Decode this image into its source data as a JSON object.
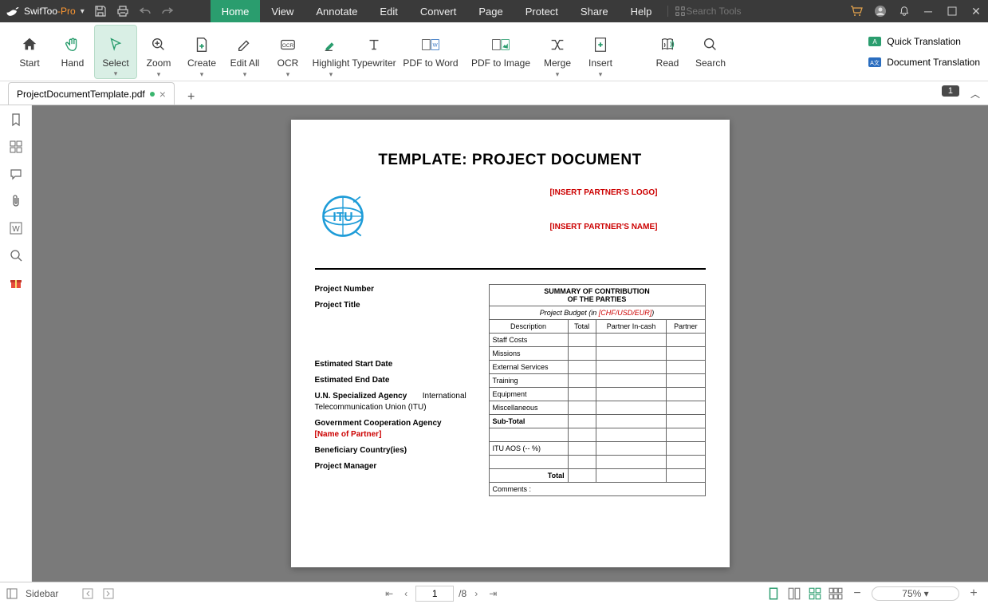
{
  "app": {
    "name_swif": "SwifToo",
    "name_pro": "-Pro"
  },
  "menu": [
    "Home",
    "View",
    "Annotate",
    "Edit",
    "Convert",
    "Page",
    "Protect",
    "Share",
    "Help"
  ],
  "search_placeholder": "Search Tools",
  "ribbon": {
    "items": [
      "Start",
      "Hand",
      "Select",
      "Zoom",
      "Create",
      "Edit All",
      "OCR",
      "Highlight",
      "Typewriter",
      "PDF to Word",
      "PDF to Image",
      "Merge",
      "Insert",
      "Read",
      "Search"
    ],
    "side": [
      "Quick Translation",
      "Document Translation"
    ]
  },
  "tab": {
    "name": "ProjectDocumentTemplate.pdf"
  },
  "page_indicator": "1",
  "doc": {
    "title": "TEMPLATE:  PROJECT DOCUMENT",
    "partner_logo": "[INSERT PARTNER'S LOGO]",
    "partner_name": "[INSERT PARTNER'S NAME]",
    "fields": {
      "proj_num": "Project Number",
      "proj_title": "Project Title",
      "est_start": "Estimated Start Date",
      "est_end": "Estimated End Date",
      "un_agency_lbl": "U.N. Specialized Agency",
      "un_agency_val": "International Telecommunication Union (ITU)",
      "gov_lbl": "Government Cooperation Agency",
      "gov_val": "[Name of Partner]",
      "ben_lbl": "Beneficiary Country(ies)",
      "pm_lbl": "Project Manager"
    },
    "table": {
      "summary1": "SUMMARY OF CONTRIBUTION",
      "summary2": "OF THE PARTIES",
      "budget_lbl": "Project Budget (in ",
      "budget_cur": "[CHF/USD/EUR]",
      "budget_end": ")",
      "cols": [
        "Description",
        "Total",
        "Partner In-cash",
        "Partner"
      ],
      "rows": [
        "Staff Costs",
        "Missions",
        "External Services",
        "Training",
        "Equipment",
        "Miscellaneous",
        "Sub-Total",
        "",
        "ITU AOS (-- %)",
        "",
        "Total"
      ],
      "comments": "Comments :"
    }
  },
  "status": {
    "sidebar_label": "Sidebar",
    "page_current": "1",
    "page_total": "/8",
    "zoom": "75%"
  }
}
